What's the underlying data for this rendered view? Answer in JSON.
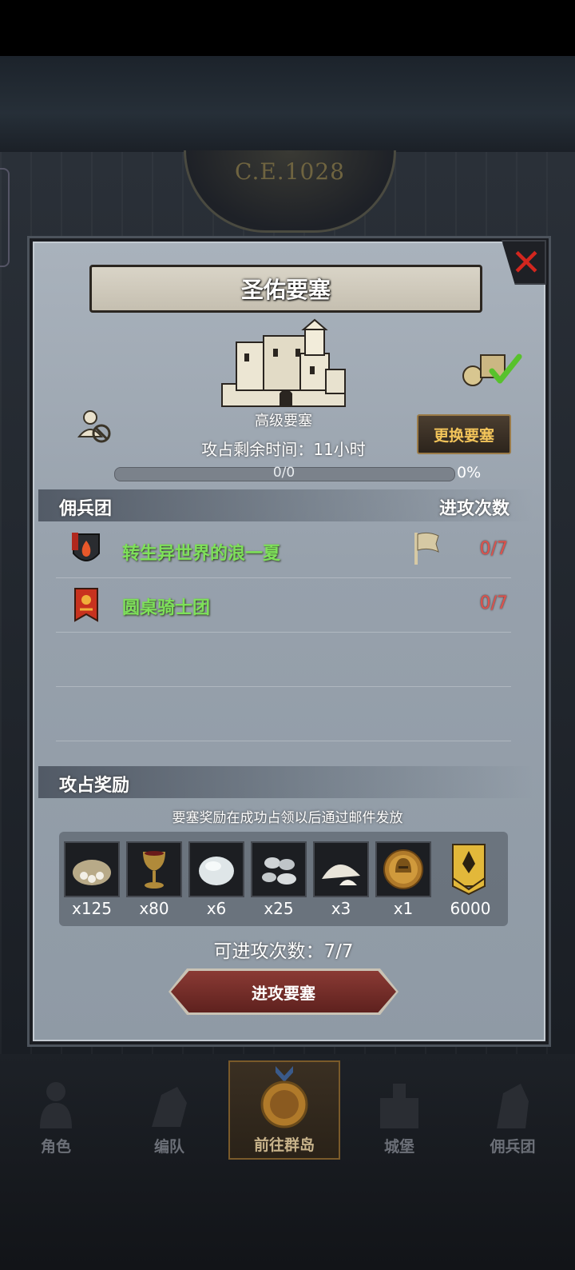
{
  "background": {
    "era_label": "C.E.1028"
  },
  "dialog": {
    "title": "圣佑要塞",
    "fortress_type": "高级要塞",
    "remaining_time": "攻占剩余时间：11小时",
    "change_button": "更换要塞",
    "progress": {
      "text": "0/0",
      "percent_label": "0%",
      "value": 0
    },
    "mercenary_section": {
      "left_header": "佣兵团",
      "right_header": "进攻次数"
    },
    "mercenaries": [
      {
        "name": "转生异世界的浪一夏",
        "attacks": "0/7",
        "emblem": "fire-shield-icon",
        "has_flag": true
      },
      {
        "name": "圆桌骑士团",
        "attacks": "0/7",
        "emblem": "red-banner-icon",
        "has_flag": false
      }
    ],
    "reward_section": {
      "header": "攻占奖励",
      "note": "要塞奖励在成功占领以后通过邮件发放"
    },
    "rewards": [
      {
        "icon": "food-sack-icon",
        "qty": "x125"
      },
      {
        "icon": "goblet-icon",
        "qty": "x80"
      },
      {
        "icon": "stone-icon",
        "qty": "x6"
      },
      {
        "icon": "silver-ore-icon",
        "qty": "x25"
      },
      {
        "icon": "salt-pile-icon",
        "qty": "x3"
      },
      {
        "icon": "helmet-coin-icon",
        "qty": "x1"
      },
      {
        "icon": "rank-badge-icon",
        "qty": "6000"
      }
    ],
    "attempts_label": "可进攻次数：7/7",
    "attack_button": "进攻要塞"
  },
  "bottom_nav": [
    {
      "label": "角色",
      "active": false
    },
    {
      "label": "编队",
      "active": false
    },
    {
      "label": "前往群岛",
      "active": true
    },
    {
      "label": "城堡",
      "active": false
    },
    {
      "label": "佣兵团",
      "active": false
    }
  ],
  "colors": {
    "accent_gold": "#f2c45a",
    "mercenary_name": "#7ee05a",
    "attack_count": "#e0524c",
    "close_x": "#d2261e"
  }
}
